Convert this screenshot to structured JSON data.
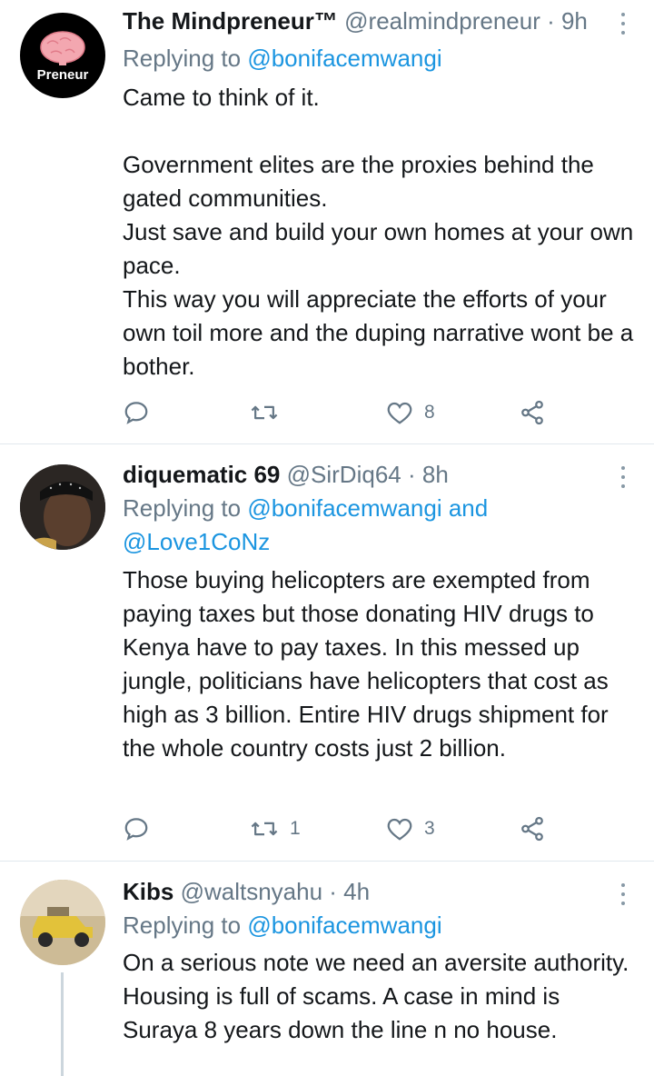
{
  "tweets": [
    {
      "name": "The Mindpreneur™",
      "handle": "@realmindpreneur",
      "time": "· 9h",
      "replying_prefix": "Replying to ",
      "replying_to": "@bonifacemwangi",
      "replying_to_2": "",
      "replying_and": "",
      "avatar_label": "Preneur",
      "body": [
        "Came to think of it.",
        "",
        "Government elites are the proxies behind the gated communities.",
        "Just save and build your own homes at your own pace.",
        "This way you will appreciate the efforts of your own toil more and the duping narrative wont be a bother."
      ],
      "replies": "",
      "retweets": "",
      "likes": "8"
    },
    {
      "name": "diquematic 69",
      "handle": "@SirDiq64",
      "time": "· 8h",
      "replying_prefix": "Replying to ",
      "replying_to": "@bonifacemwangi",
      "replying_and": " and",
      "replying_to_2": "@Love1CoNz",
      "body": [
        "Those buying helicopters are exempted from paying taxes but those donating HIV drugs to Kenya have to pay taxes. In this messed up jungle, politicians have helicopters that cost as high as 3 billion. Entire HIV drugs shipment for the whole country costs just 2 billion."
      ],
      "replies": "",
      "retweets": "1",
      "likes": "3"
    },
    {
      "name": "Kibs",
      "handle": "@waltsnyahu",
      "time": "· 4h",
      "replying_prefix": "Replying to ",
      "replying_to": "@bonifacemwangi",
      "replying_and": "",
      "replying_to_2": "",
      "body": [
        "On a serious note we need an aversite authority. Housing is full of scams. A case in mind is Suraya 8 years down the line n no house."
      ]
    }
  ],
  "icons": [
    "reply-icon",
    "retweet-icon",
    "like-icon",
    "share-icon",
    "more-icon"
  ],
  "colors": {
    "link": "#1b95e0",
    "secondary": "#657786",
    "icon": "#657786",
    "divider": "#e1e8ed"
  }
}
